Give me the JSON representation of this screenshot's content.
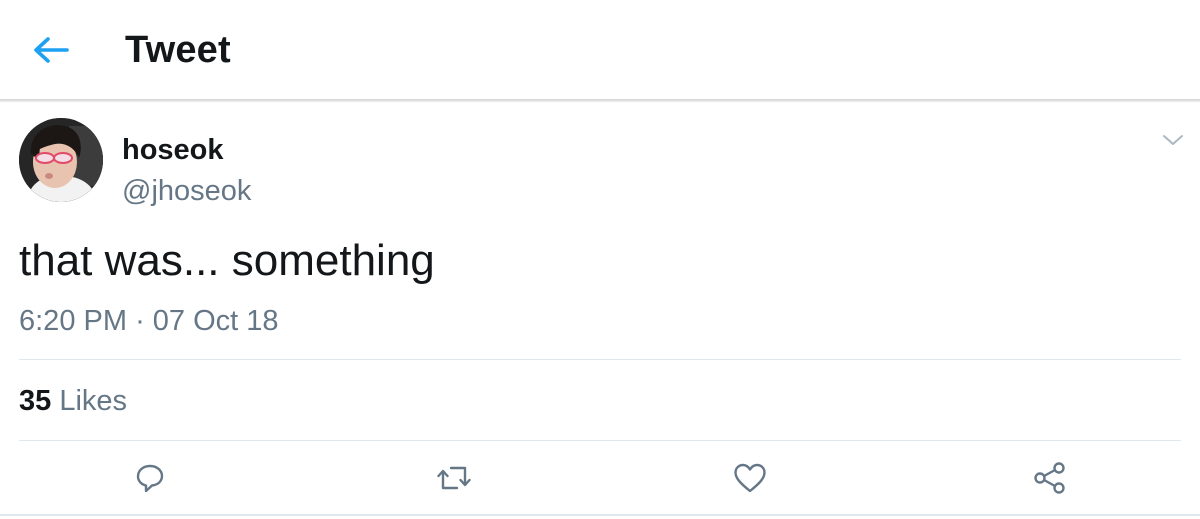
{
  "header": {
    "title": "Tweet",
    "back_icon": "arrow-left-icon",
    "accent_color": "#1da1f2"
  },
  "tweet": {
    "author": {
      "display_name": "hoseok",
      "handle": "@jhoseok",
      "avatar": "profile-photo"
    },
    "text": "that was... something",
    "time": "6:20 PM",
    "separator": "·",
    "date": "07 Oct 18",
    "stats": {
      "likes_count": "35",
      "likes_label": "Likes"
    },
    "menu_icon": "chevron-down-icon"
  },
  "actions": [
    {
      "name": "reply",
      "icon": "reply-icon"
    },
    {
      "name": "retweet",
      "icon": "retweet-icon"
    },
    {
      "name": "like",
      "icon": "heart-icon"
    },
    {
      "name": "share",
      "icon": "share-icon"
    }
  ],
  "colors": {
    "text_primary": "#14171a",
    "text_secondary": "#657786",
    "divider": "#e1e8ed"
  }
}
